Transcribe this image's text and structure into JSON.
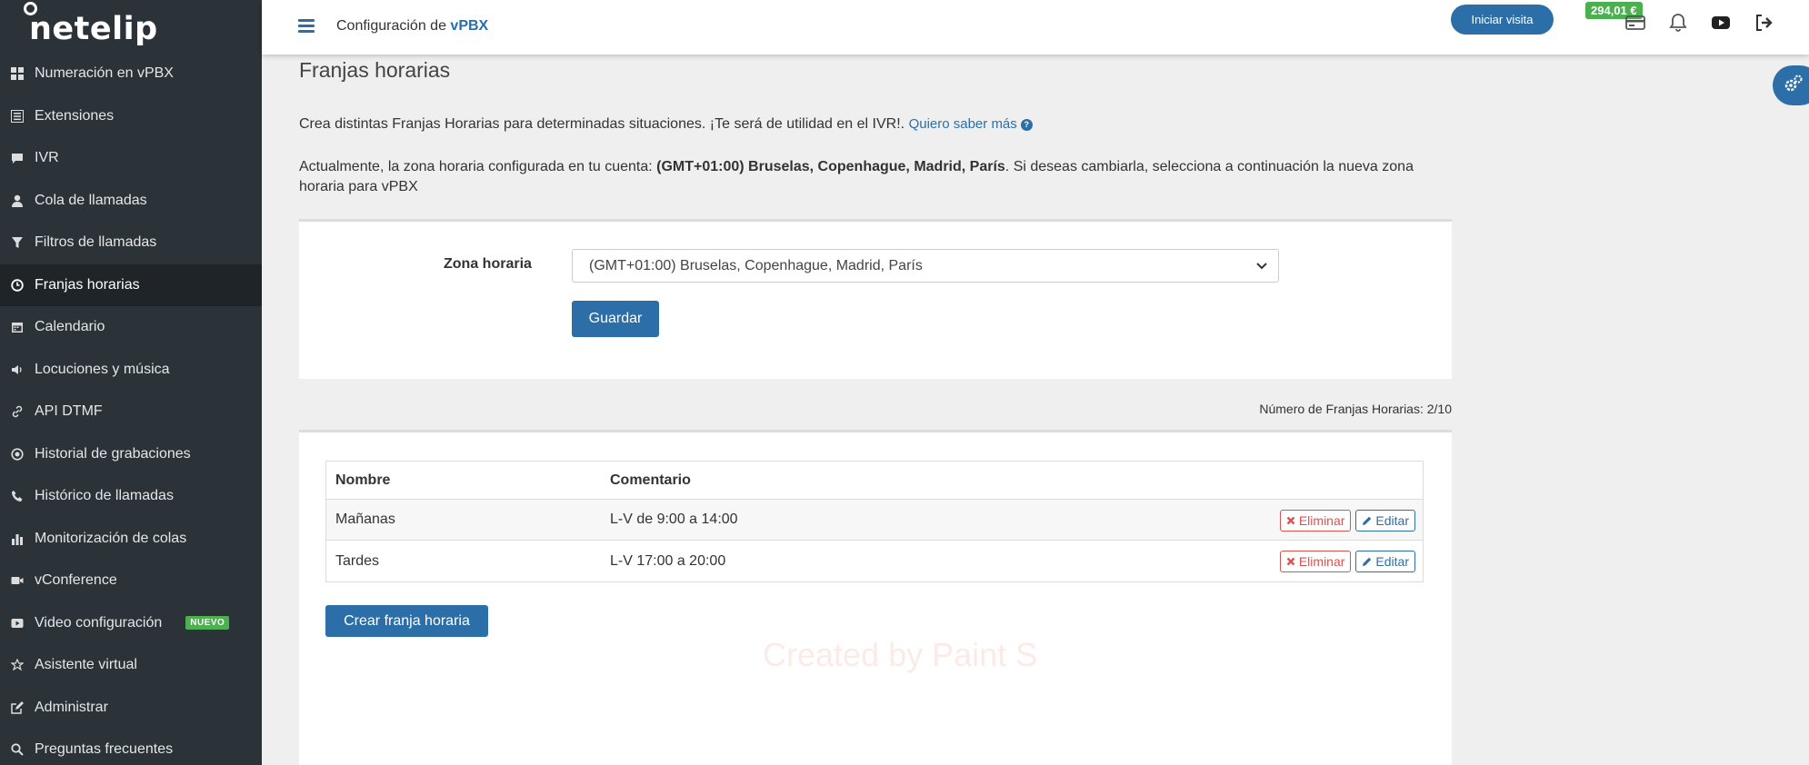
{
  "brand": {
    "logo_text": "netelip"
  },
  "topbar": {
    "title_prefix": "Configuración de ",
    "title_emphasis": "vPBX",
    "visit_button": "Iniciar visita",
    "balance": "294,01 €"
  },
  "sidebar": {
    "items": [
      {
        "label": "Numeración en vPBX",
        "icon": "grid-icon"
      },
      {
        "label": "Extensiones",
        "icon": "list-icon"
      },
      {
        "label": "IVR",
        "icon": "chat-icon"
      },
      {
        "label": "Cola de llamadas",
        "icon": "user-icon"
      },
      {
        "label": "Filtros de llamadas",
        "icon": "filter-icon"
      },
      {
        "label": "Franjas horarias",
        "icon": "clock-icon"
      },
      {
        "label": "Calendario",
        "icon": "calendar-icon"
      },
      {
        "label": "Locuciones y música",
        "icon": "speaker-icon"
      },
      {
        "label": "API DTMF",
        "icon": "link-icon"
      },
      {
        "label": "Historial de grabaciones",
        "icon": "record-icon"
      },
      {
        "label": "Histórico de llamadas",
        "icon": "phone-icon"
      },
      {
        "label": "Monitorización de colas",
        "icon": "bar-chart-icon"
      },
      {
        "label": "vConference",
        "icon": "video-camera-icon"
      },
      {
        "label": "Video configuración",
        "icon": "play-icon"
      },
      {
        "label": "Asistente virtual",
        "icon": "star-icon"
      },
      {
        "label": "Administrar",
        "icon": "edit-icon"
      },
      {
        "label": "Preguntas frecuentes",
        "icon": "search-icon"
      }
    ],
    "new_badge": "NUEVO"
  },
  "main": {
    "page_title": "Franjas horarias",
    "intro_text": "Crea distintas Franjas Horarias para determinadas situaciones. ¡Te será de utilidad en el IVR!.",
    "intro_link": "Quiero saber más",
    "tz_info_prefix": "Actualmente, la zona horaria configurada en tu cuenta: ",
    "tz_info_current": "(GMT+01:00) Bruselas, Copenhague, Madrid, París",
    "tz_info_suffix": ". Si deseas cambiarla, selecciona a continuación la nueva zona horaria para vPBX",
    "tz_label": "Zona horaria",
    "tz_selected": "(GMT+01:00) Bruselas, Copenhague, Madrid, París",
    "save_button": "Guardar",
    "count_text": "Número de Franjas Horarias: 2/10",
    "table": {
      "headers": [
        "Nombre",
        "Comentario"
      ],
      "rows": [
        {
          "name": "Mañanas",
          "comment": "L-V de 9:00 a 14:00"
        },
        {
          "name": "Tardes",
          "comment": "L-V 17:00 a 20:00"
        }
      ],
      "delete_label": "Eliminar",
      "edit_label": "Editar"
    },
    "create_button": "Crear franja horaria",
    "watermark": "Created by Paint S"
  },
  "colors": {
    "accent": "#2c6fa8",
    "sidebar_bg": "#2b3338",
    "success": "#4caf50",
    "danger": "#d9534f"
  }
}
